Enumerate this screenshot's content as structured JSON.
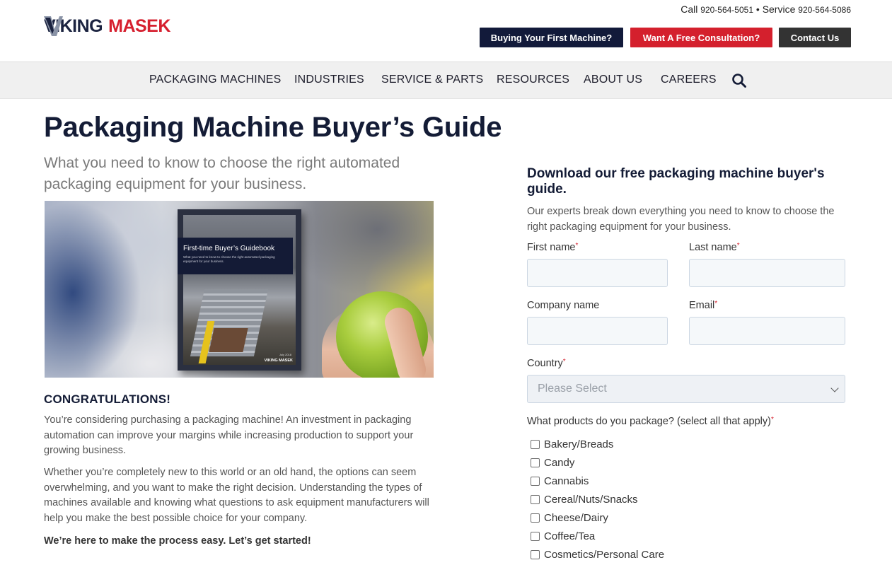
{
  "header": {
    "logo": {
      "part1": "VIKING",
      "part2": "MASEK"
    },
    "phones": {
      "call_label": "Call",
      "call_number": "920-564-5051",
      "separator": "•",
      "service_label": "Service",
      "service_number": "920-564-5086"
    },
    "buttons": {
      "first_machine": "Buying Your First Machine?",
      "consultation": "Want A Free Consultation?",
      "contact": "Contact Us"
    }
  },
  "nav": {
    "items": [
      "PACKAGING MACHINES",
      "INDUSTRIES",
      "SERVICE & PARTS",
      "RESOURCES",
      "ABOUT US",
      "CAREERS"
    ],
    "search_icon": "search-icon"
  },
  "main": {
    "title": "Packaging Machine Buyer’s Guide",
    "subtitle": "What you need to know to choose the right automated packaging equipment for your business.",
    "hero": {
      "book_title": "First-time Buyer’s Guidebook",
      "book_subtitle": "What you need to know to choose the right automated packaging equipment for your business.",
      "book_date": "July 2018",
      "book_logo": "VIKING MASEK"
    },
    "congrats_heading": "CONGRATULATIONS!",
    "para1": "You’re considering purchasing a packaging machine! An investment in packaging automation can improve your margins while increasing production to support your growing business.",
    "para2": "Whether you’re completely new to this world or an old hand, the options can seem overwhelming, and you want to make the right decision. Understanding the types of machines available and knowing what questions to ask equipment manufacturers will help you make the best possible choice for your company.",
    "para3": "We’re here to make the process easy. Let’s get started!"
  },
  "form": {
    "title": "Download our free packaging machine buyer's guide.",
    "description": "Our experts break down everything you need to know to choose the right packaging equipment for your business.",
    "required_mark": "*",
    "fields": {
      "first_name": "First name",
      "last_name": "Last name",
      "company": "Company name",
      "email": "Email",
      "country": "Country"
    },
    "country_placeholder": "Please Select",
    "products_label": "What products do you package? (select all that apply)",
    "products": [
      "Bakery/Breads",
      "Candy",
      "Cannabis",
      "Cereal/Nuts/Snacks",
      "Cheese/Dairy",
      "Coffee/Tea",
      "Cosmetics/Personal Care"
    ]
  },
  "colors": {
    "navy": "#121a3a",
    "red": "#d4202d",
    "dark_gray": "#333333",
    "nav_bg": "#f0f0f0",
    "input_bg": "#f5f8fa"
  }
}
